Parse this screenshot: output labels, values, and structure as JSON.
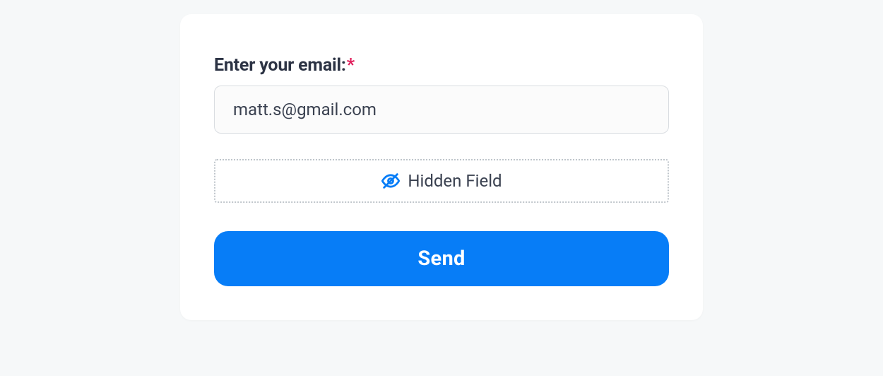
{
  "form": {
    "email_label": "Enter your email:",
    "required_mark": "*",
    "email_value": "matt.s@gmail.com",
    "hidden_field_label": "Hidden Field",
    "submit_label": "Send"
  },
  "colors": {
    "accent_blue": "#077df7",
    "required_red": "#e11e5b",
    "text_dark": "#2c3344"
  }
}
